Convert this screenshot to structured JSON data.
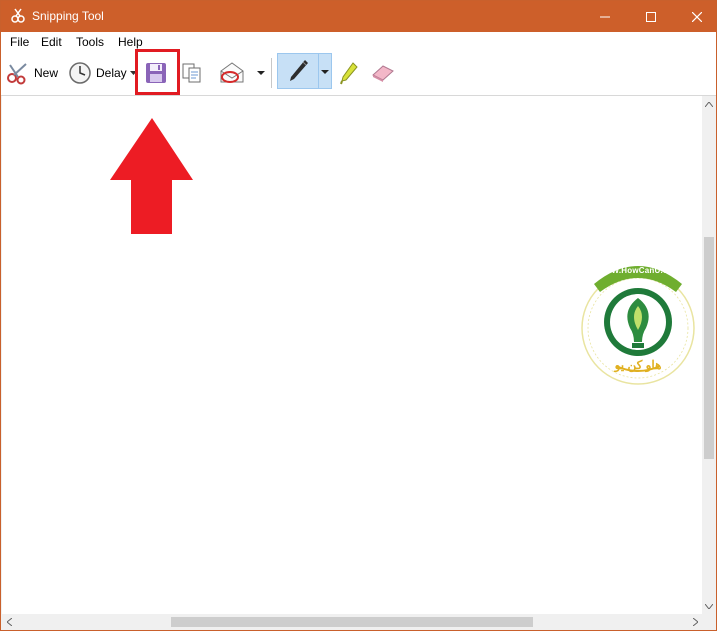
{
  "window": {
    "title": "Snipping Tool",
    "controls": {
      "minimize": "minimize",
      "maximize": "maximize",
      "close": "close"
    }
  },
  "menu": [
    "File",
    "Edit",
    "Tools",
    "Help"
  ],
  "toolbar": {
    "new_label": "New",
    "delay_label": "Delay",
    "icons": [
      "scissors-icon",
      "clock-icon",
      "save-icon",
      "copy-icon",
      "send-email-icon",
      "pen-icon",
      "highlighter-icon",
      "eraser-icon"
    ]
  },
  "annotations": {
    "arrow_color": "#ed1c24",
    "highlight_color": "#e11b22"
  },
  "watermark": {
    "top_text": "WWW.HowCanU.com",
    "arabic_text": "هاو کن یو"
  },
  "colors": {
    "titlebar": "#cd5f2a",
    "pen_active": "#c7e0f6"
  }
}
